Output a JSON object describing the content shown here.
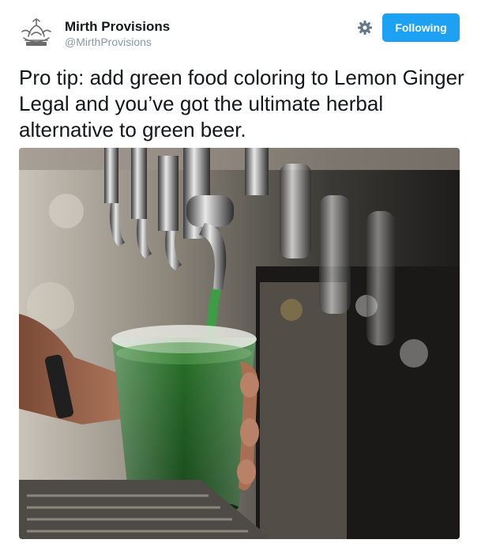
{
  "author": {
    "name": "Mirth Provisions",
    "handle": "@MirthProvisions",
    "avatar_icon": "crest-logo-icon"
  },
  "actions": {
    "settings_icon": "gear-icon",
    "follow_label": "Following",
    "follow_color": "#1da1f2"
  },
  "tweet": {
    "text": "Pro tip: add green food coloring to Lemon Ginger Legal and you’ve got the ultimate herbal alternative to green beer."
  },
  "media": {
    "description_icon": "photo"
  },
  "colors": {
    "text": "#14171a",
    "muted": "#8899a6",
    "accent": "#1da1f2"
  }
}
